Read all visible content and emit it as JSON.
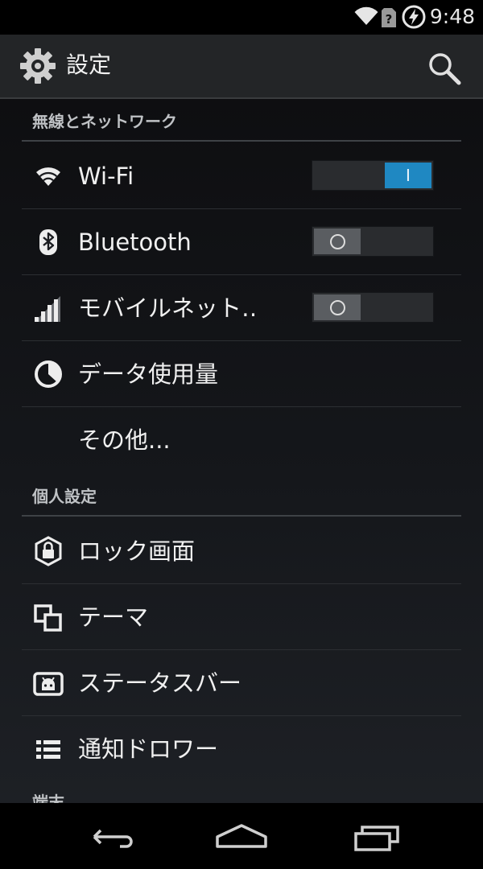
{
  "status_bar": {
    "time": "9:48",
    "icons": [
      "wifi-signal-icon",
      "sim-unknown-icon",
      "battery-charging-icon"
    ]
  },
  "action_bar": {
    "title": "設定",
    "app_icon": "settings-gear-icon",
    "search_icon": "search-icon"
  },
  "sections": [
    {
      "header": "無線とネットワーク",
      "items": [
        {
          "label": "Wi-Fi",
          "icon": "wifi-icon",
          "toggle": {
            "state": "on",
            "mark": "I"
          }
        },
        {
          "label": "Bluetooth",
          "icon": "bluetooth-icon",
          "toggle": {
            "state": "off",
            "mark": "O"
          }
        },
        {
          "label": "モバイルネット‥",
          "icon": "signal-bars-icon",
          "toggle": {
            "state": "off",
            "mark": "O"
          }
        },
        {
          "label": "データ使用量",
          "icon": "data-usage-icon"
        },
        {
          "label": "その他..."
        }
      ]
    },
    {
      "header": "個人設定",
      "items": [
        {
          "label": "ロック画面",
          "icon": "lock-screen-icon"
        },
        {
          "label": "テーマ",
          "icon": "theme-icon"
        },
        {
          "label": "ステータスバー",
          "icon": "status-bar-icon"
        },
        {
          "label": "通知ドロワー",
          "icon": "notification-drawer-icon"
        }
      ]
    }
  ],
  "next_header_peek": "端末",
  "nav_bar": [
    "back-icon",
    "home-icon",
    "recents-icon"
  ],
  "colors": {
    "accent": "#1f88c2",
    "background": "#15171b",
    "action_bar": "#232527",
    "text": "#f0f0f0",
    "header_text": "#bfc2c5"
  }
}
